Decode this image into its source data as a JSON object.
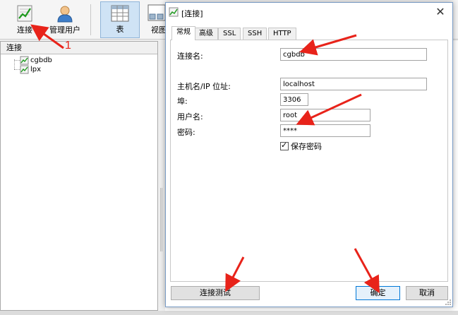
{
  "toolbar": {
    "connect_label": "连接",
    "users_label": "管理用户",
    "table_label": "表",
    "view_label": "视图"
  },
  "left_panel": {
    "header": "连接",
    "connections": [
      {
        "name": "cgbdb"
      },
      {
        "name": "lpx"
      }
    ]
  },
  "dialog": {
    "title": "[连接]",
    "close_glyph": "✕",
    "tabs": [
      {
        "label": "常规",
        "active": true
      },
      {
        "label": "高级",
        "active": false
      },
      {
        "label": "SSL",
        "active": false
      },
      {
        "label": "SSH",
        "active": false
      },
      {
        "label": "HTTP",
        "active": false
      }
    ],
    "fields": {
      "connection_name": {
        "label": "连接名:",
        "value": "cgbdb"
      },
      "host": {
        "label": "主机名/IP 位址:",
        "value": "localhost"
      },
      "port": {
        "label": "埠:",
        "value": "3306"
      },
      "username": {
        "label": "用户名:",
        "value": "root"
      },
      "password": {
        "label": "密码:",
        "value": "****"
      }
    },
    "save_password": {
      "label": "保存密码",
      "checked": true
    },
    "buttons": {
      "test": "连接测试",
      "ok": "确定",
      "cancel": "取消"
    }
  },
  "annotation": {
    "number": "1",
    "color": "#e8231a"
  }
}
